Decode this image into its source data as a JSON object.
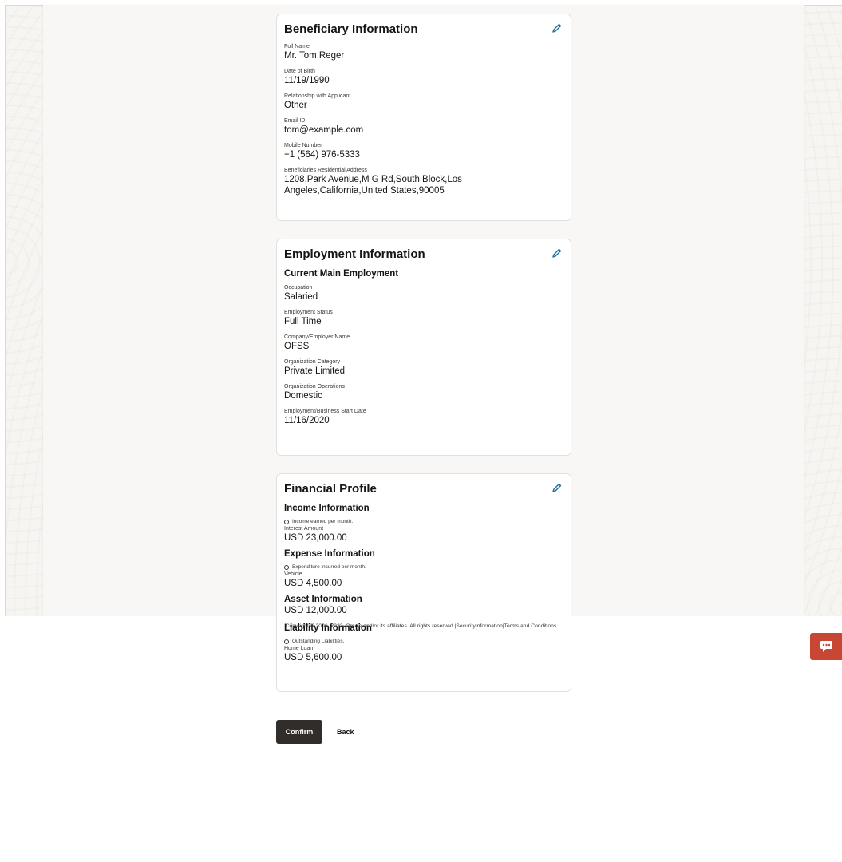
{
  "beneficiary": {
    "title": "Beneficiary Information",
    "edit_icon": "pencil-icon",
    "fields": [
      {
        "label": "Full Name",
        "value": "Mr. Tom Reger"
      },
      {
        "label": "Date of Birth",
        "value": "11/19/1990"
      },
      {
        "label": "Relationship with Applicant",
        "value": "Other"
      },
      {
        "label": "Email ID",
        "value": "tom@example.com"
      },
      {
        "label": "Mobile Number",
        "value": "+1 (564) 976-5333"
      },
      {
        "label": "Beneficiaries Residential Address",
        "value": "1208,Park Avenue,M G Rd,South Block,Los Angeles,California,United States,90005"
      }
    ]
  },
  "employment": {
    "title": "Employment Information",
    "subtitle": "Current Main Employment",
    "fields": [
      {
        "label": "Occupation",
        "value": "Salaried"
      },
      {
        "label": "Employment Status",
        "value": "Full Time"
      },
      {
        "label": "Company/Employer Name",
        "value": "OFSS"
      },
      {
        "label": "Organization Category",
        "value": "Private Limited"
      },
      {
        "label": "Organization Operations",
        "value": "Domestic"
      },
      {
        "label": "Employment/Business Start Date",
        "value": "11/16/2020"
      }
    ]
  },
  "financial": {
    "title": "Financial Profile",
    "income": {
      "heading": "Income Information",
      "hint": "Income earned per month.",
      "label": "Interest Amount",
      "value": "USD 23,000.00"
    },
    "expense": {
      "heading": "Expense Information",
      "hint": "Expenditure incurred per month.",
      "label": "Vehicle",
      "value": "USD 4,500.00"
    },
    "asset": {
      "heading": "Asset Information",
      "value": "USD 12,000.00"
    },
    "liability": {
      "heading": "Liability Information",
      "hint": "Outstanding Liabilities.",
      "label": "Home Loan",
      "value": "USD 5,600.00"
    }
  },
  "actions": {
    "confirm_label": "Confirm",
    "back_label": "Back"
  },
  "footer": {
    "copyright": "Copyright © 2006, 2023, Oracle and/or its affiliates. All rights reserved.",
    "security_link": "SecurityInformation",
    "terms_link": "Terms and Conditions",
    "separator": "|"
  },
  "colors": {
    "primary_button": "#312d2a",
    "chat_button": "#c74634",
    "edit_icon": "#1a6ea3"
  },
  "chat_icon": "chat-bubble-icon"
}
